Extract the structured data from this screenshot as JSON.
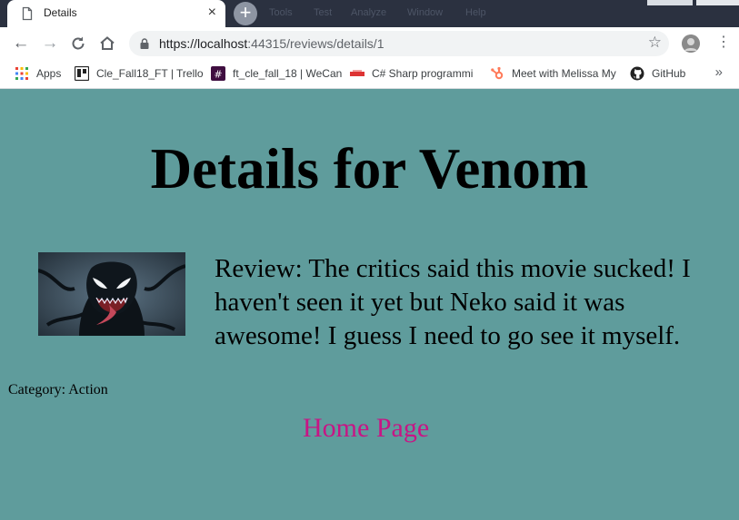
{
  "browser": {
    "tab": {
      "title": "Details",
      "close_glyph": "×"
    },
    "new_tab_glyph": "+",
    "ghost_menu": [
      "Tools",
      "Test",
      "Analyze",
      "Window",
      "Help"
    ],
    "url_host": "https://localhost",
    "url_rest": ":44315/reviews/details/1",
    "bookmarks": [
      {
        "label": "Apps",
        "icon": "apps-grid-icon"
      },
      {
        "label": "Cle_Fall18_FT | Trello",
        "icon": "trello-icon"
      },
      {
        "label": "ft_cle_fall_18 | WeCan",
        "icon": "slack-icon"
      },
      {
        "label": "C# Sharp programmi",
        "icon": "w3resource-icon"
      },
      {
        "label": "Meet with Melissa My",
        "icon": "hubspot-icon"
      },
      {
        "label": "GitHub",
        "icon": "github-icon"
      }
    ],
    "bookmarks_more": "»"
  },
  "page": {
    "heading": "Details for Venom",
    "review": "Review: The critics said this movie sucked! I haven't seen it yet but Neko said it was awesome! I guess I need to go see it myself.",
    "category": "Category: Action",
    "home_link": "Home Page"
  },
  "colors": {
    "page_background": "#5f9c9c",
    "link": "#c71585"
  }
}
